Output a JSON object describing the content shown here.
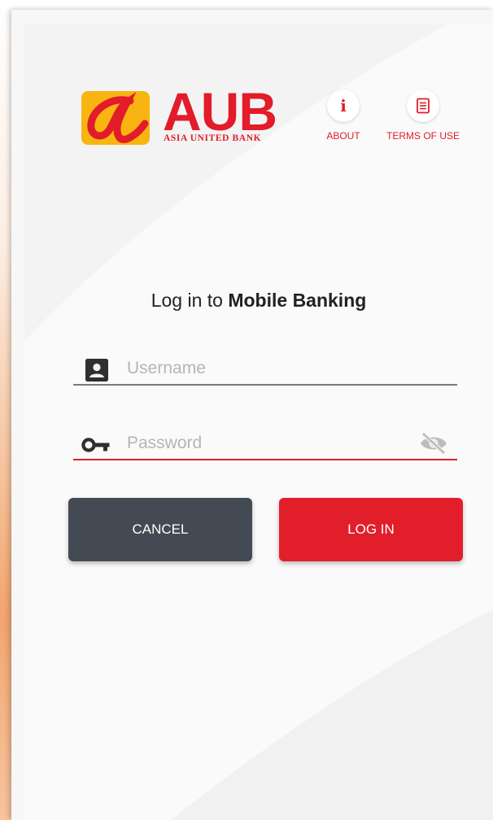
{
  "brand": {
    "name": "AUB",
    "full_name": "ASIA UNITED BANK",
    "primary_color": "#e21c2a",
    "mark_color": "#f8b511"
  },
  "header": {
    "about": {
      "label": "ABOUT",
      "icon": "info-icon"
    },
    "terms": {
      "label": "TERMS OF USE",
      "icon": "document-icon"
    }
  },
  "login": {
    "title_prefix": "Log in to ",
    "title_bold": "Mobile Banking",
    "username": {
      "placeholder": "Username",
      "value": "",
      "icon": "account-box-icon"
    },
    "password": {
      "placeholder": "Password",
      "value": "",
      "icon": "key-icon",
      "toggle_icon": "eye-off-icon"
    },
    "cancel_label": "CANCEL",
    "login_label": "LOG IN",
    "cancel_color": "#434a54",
    "login_color": "#e31e2b"
  }
}
